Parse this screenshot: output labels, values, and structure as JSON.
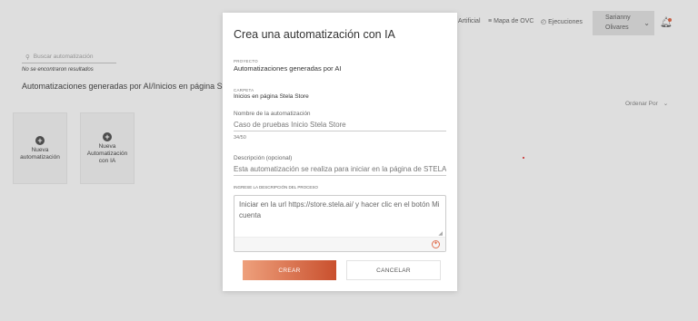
{
  "nav": {
    "link_artificial": "Artificial",
    "link_mapa": "Mapa de OVC",
    "link_ejecuciones": "Ejecuciones",
    "user_name_line1": "Sarianny",
    "user_name_line2": "Olivares"
  },
  "page": {
    "search_placeholder": "Buscar automatización",
    "no_results": "No se encontraron resultados",
    "section_title": "Automatizaciones generadas por AI/Inicios en página Ste",
    "order_by": "Ordenar Por",
    "cards": [
      {
        "line1": "Nueva",
        "line2": "automatización",
        "line3": ""
      },
      {
        "line1": "Nueva",
        "line2": "Automatización",
        "line3": "con IA"
      }
    ]
  },
  "modal": {
    "title": "Crea una automatización con IA",
    "project_label": "PROYECTO",
    "project_value": "Automatizaciones generadas por AI",
    "folder_label": "CARPETA",
    "folder_value": "Inicios en página Stela Store",
    "name_label": "Nombre de la automatización",
    "name_value": "Caso de pruebas Inicio Stela Store",
    "name_counter": "34/50",
    "desc_label": "Descripción (opcional)",
    "desc_value": "Esta automatización se realiza para iniciar en la página de STELA STORE",
    "process_label": "INGRESE LA DESCRIPCIÓN DEL PROCESO",
    "process_value": "Iniciar en la url https://store.stela.ai/ y hacer clic en el botón Mi cuenta",
    "create_label": "CREAR",
    "cancel_label": "CANCELAR"
  },
  "icons": [
    "search-icon",
    "map-icon",
    "clock-icon",
    "chevron-down-icon",
    "bell-icon",
    "plus-circle-icon",
    "ai-assist-icon"
  ],
  "colors": {
    "accent_start": "#eea07c",
    "accent_end": "#c9502e"
  }
}
